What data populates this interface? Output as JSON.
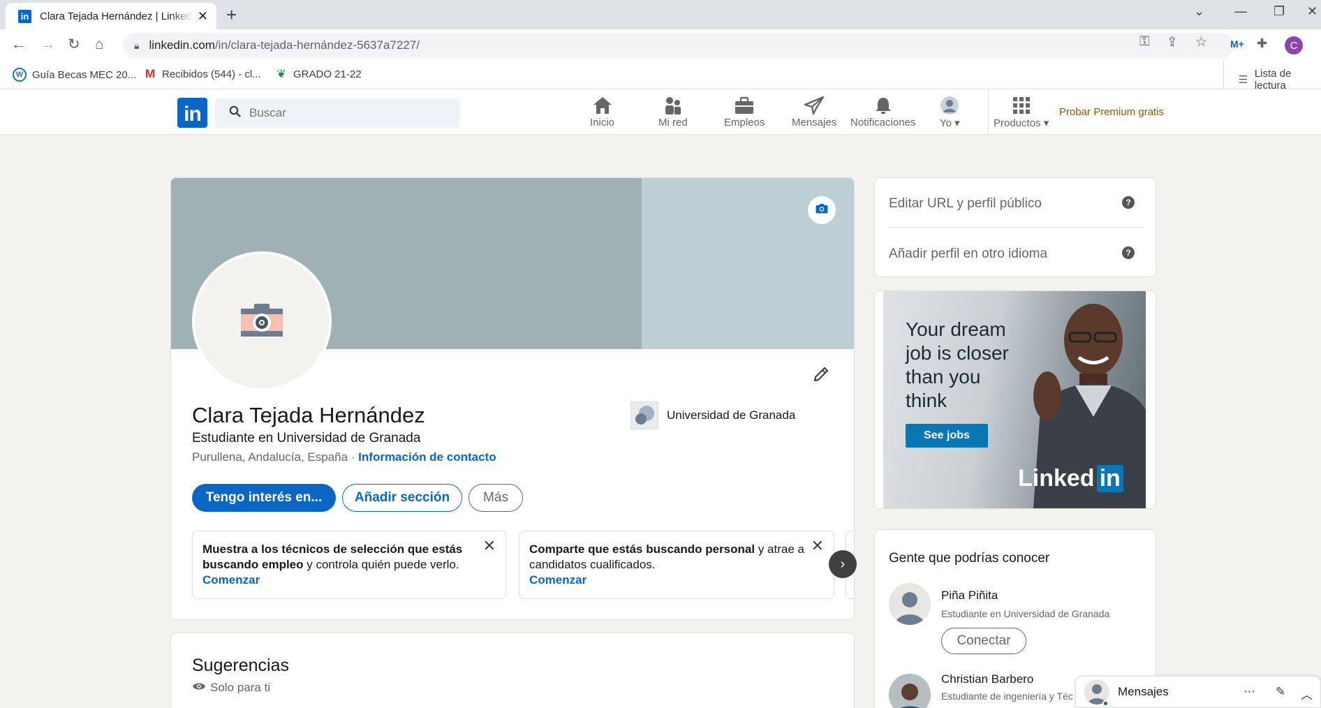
{
  "browser": {
    "tab_title": "Clara Tejada Hernández | LinkedIn",
    "tab_favicon": "in",
    "url_domain": "linkedin.com",
    "url_path": "/in/clara-tejada-hernández-5637a7227/",
    "profile_initial": "C",
    "bookmarks": [
      {
        "label": "Guía Becas MEC 20..."
      },
      {
        "label": "Recibidos (544) - cl..."
      },
      {
        "label": "GRADO 21-22"
      }
    ],
    "reading_list": "Lista de lectura"
  },
  "nav": {
    "logo": "in",
    "search_placeholder": "Buscar",
    "items": [
      {
        "label": "Inicio",
        "icon": "home-icon"
      },
      {
        "label": "Mi red",
        "icon": "network-icon"
      },
      {
        "label": "Empleos",
        "icon": "jobs-icon"
      },
      {
        "label": "Mensajes",
        "icon": "messaging-icon"
      },
      {
        "label": "Notificaciones",
        "icon": "bell-icon"
      },
      {
        "label": "Yo",
        "icon": "avatar-icon"
      },
      {
        "label": "Productos",
        "icon": "grid-icon"
      }
    ],
    "premium": "Probar Premium gratis"
  },
  "profile": {
    "name": "Clara Tejada Hernández",
    "headline": "Estudiante en Universidad de Granada",
    "location": "Purullena, Andalucía, España",
    "separator": " · ",
    "contact_link": "Información de contacto",
    "school": "Universidad de Granada",
    "buttons": {
      "open_to": "Tengo interés en...",
      "add_section": "Añadir sección",
      "more": "Más"
    },
    "cards": [
      {
        "bold": "Muestra a los técnicos de selección que estás buscando empleo",
        "rest": " y controla quién puede verlo.",
        "cta": "Comenzar"
      },
      {
        "bold": "Comparte que estás buscando personal",
        "rest": " y atrae a candidatos cualificados.",
        "cta": "Comenzar"
      }
    ]
  },
  "suggestions": {
    "title": "Sugerencias",
    "subtitle": "Solo para ti"
  },
  "right_rail": {
    "edit_url": "Editar URL y perfil público",
    "add_language": "Añadir perfil en otro idioma",
    "ad": {
      "text": "Your dream job is closer than you think",
      "line1": "Your dream",
      "line2": "job is closer",
      "line3": "than you",
      "line4": "think",
      "button": "See jobs",
      "brand": "Linked",
      "brand_in": "in"
    },
    "pymk_title": "Gente que podrías conocer",
    "people": [
      {
        "name": "Piña Piñita",
        "sub": "Estudiante en Universidad de Granada",
        "action": "Conectar"
      },
      {
        "name": "Christian Barbero",
        "sub": "Estudiante de ingeniería y Téc"
      }
    ]
  },
  "messaging": {
    "title": "Mensajes"
  }
}
